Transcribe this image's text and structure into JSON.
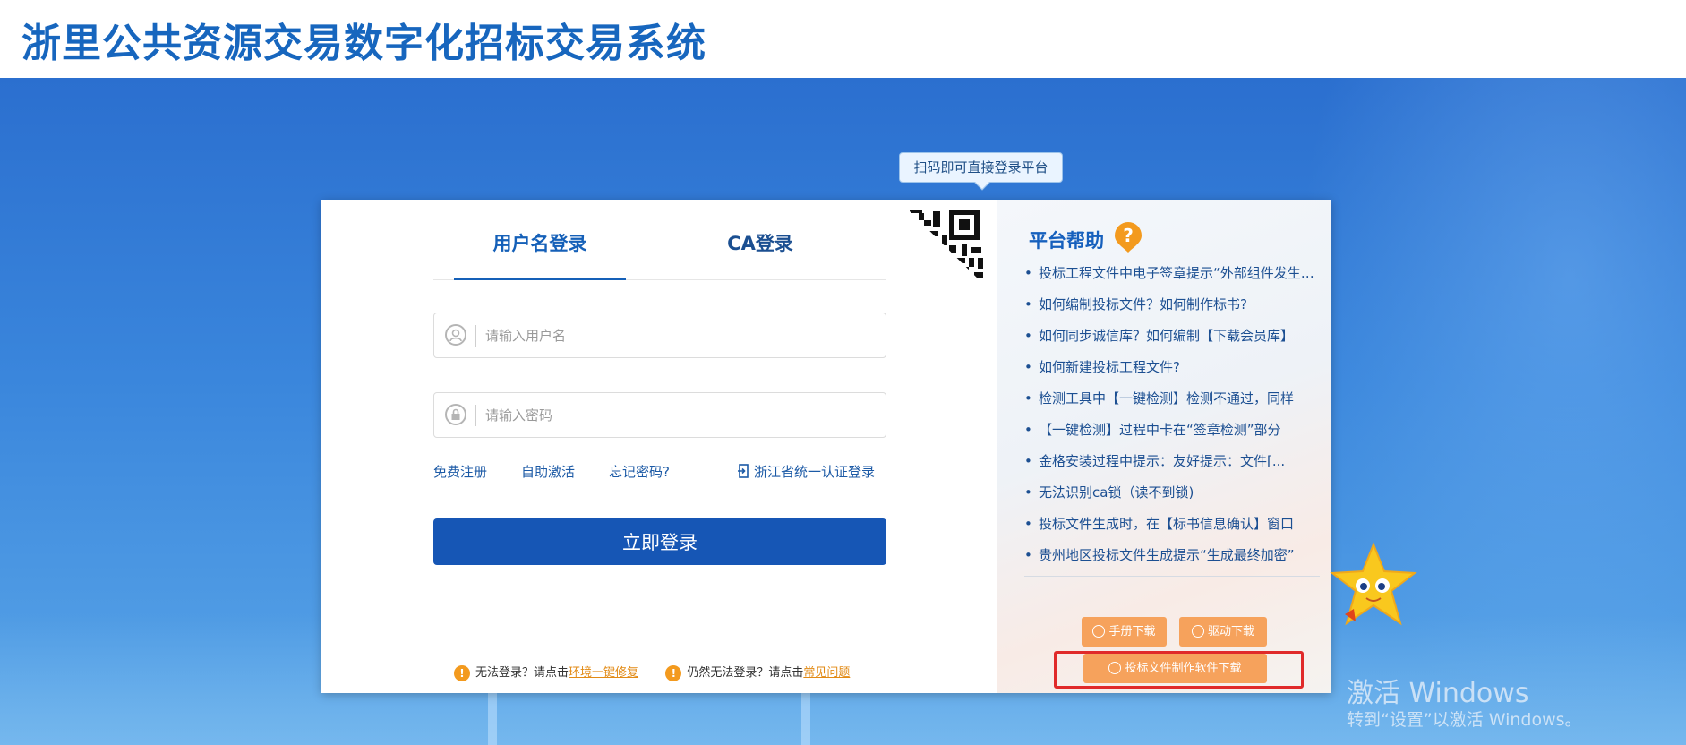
{
  "header": {
    "title": "浙里公共资源交易数字化招标交易系统"
  },
  "login": {
    "tabs": [
      {
        "label": "用户名登录",
        "active": true
      },
      {
        "label": "CA登录",
        "active": false
      }
    ],
    "username": {
      "value": "",
      "placeholder": "请输入用户名",
      "icon": "user-icon"
    },
    "password": {
      "value": "",
      "placeholder": "请输入密码",
      "icon": "lock-icon"
    },
    "links": {
      "register": "免费注册",
      "activate": "自助激活",
      "forgot": "忘记密码?",
      "sso": "浙江省统一认证登录"
    },
    "submit_label": "立即登录",
    "notices": {
      "n1_text": "无法登录？请点击",
      "n1_link": "环境一键修复",
      "n2_text": "仍然无法登录？请点击",
      "n2_link": "常见问题"
    }
  },
  "qr": {
    "tooltip": "扫码即可直接登录平台"
  },
  "help": {
    "title": "平台帮助",
    "items": [
      "投标工程文件中电子签章提示“外部组件发生异常”",
      "如何编制投标文件？如何制作标书?",
      "如何同步诚信库？如何编制【下载会员库】",
      "如何新建投标工程文件?",
      "检测工具中【一键检测】检测不通过，同样",
      "【一键检测】过程中卡在“签章检测”部分",
      "金格安装过程中提示：友好提示：文件[...",
      "无法识别ca锁（读不到锁)",
      "投标文件生成时，在【标书信息确认】窗口",
      "贵州地区投标文件生成提示“生成最终加密”"
    ],
    "buttons": {
      "manual": "手册下载",
      "driver": "驱动下载",
      "software": "投标文件制作软件下载"
    }
  },
  "watermark": {
    "line1": "激活 Windows",
    "line2": "转到“设置”以激活 Windows。"
  },
  "colors": {
    "brand": "#1656b5",
    "accent_orange": "#f6a25c",
    "highlight_red": "#e02a2a"
  }
}
